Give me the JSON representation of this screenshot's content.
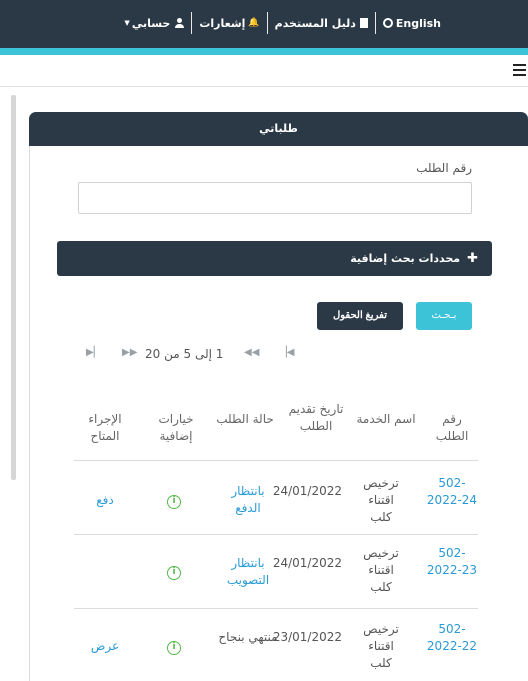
{
  "topnav": {
    "english": "English",
    "user_guide": "دليل المستخدم",
    "notifications": "إشعارات",
    "my_account": "حسابي"
  },
  "panel": {
    "title": "طلباتي"
  },
  "search": {
    "field_label": "رقم الطلب",
    "input_value": "",
    "advanced_label": "محددات بحث إضافية",
    "search_button": "بـحـث",
    "clear_button": "تفريغ الحقول"
  },
  "pager": {
    "info": "1 إلى 5 من 20"
  },
  "table": {
    "headers": [
      "رقم الطلب",
      "اسم الخدمة",
      "تاريخ تقديم الطلب",
      "حالة الطلب",
      "خيارات إضافية",
      "الإجراء المتاح"
    ],
    "rows": [
      {
        "number": "502-2022-24",
        "service": "ترخيص اقتناء كلب",
        "date": "24/01/2022",
        "status": "بانتظار الدفع",
        "action": "دفع"
      },
      {
        "number": "502-2022-23",
        "service": "ترخيص اقتناء كلب",
        "date": "24/01/2022",
        "status": "بانتظار التصويب",
        "action": ""
      },
      {
        "number": "502-2022-22",
        "service": "ترخيص اقتناء كلب",
        "date": "23/01/2022",
        "status": "منتهي بنجاح",
        "action": "عرض"
      }
    ]
  },
  "colors": {
    "navy": "#2b3846",
    "accent": "#3cc3d8",
    "link": "#2a9ad6",
    "info": "#55b94b"
  },
  "icons": [
    "globe-icon",
    "book-icon",
    "bell-icon",
    "user-icon",
    "menu-icon",
    "plus-icon",
    "first-page-icon",
    "prev-page-icon",
    "next-page-icon",
    "last-page-icon",
    "info-icon"
  ]
}
